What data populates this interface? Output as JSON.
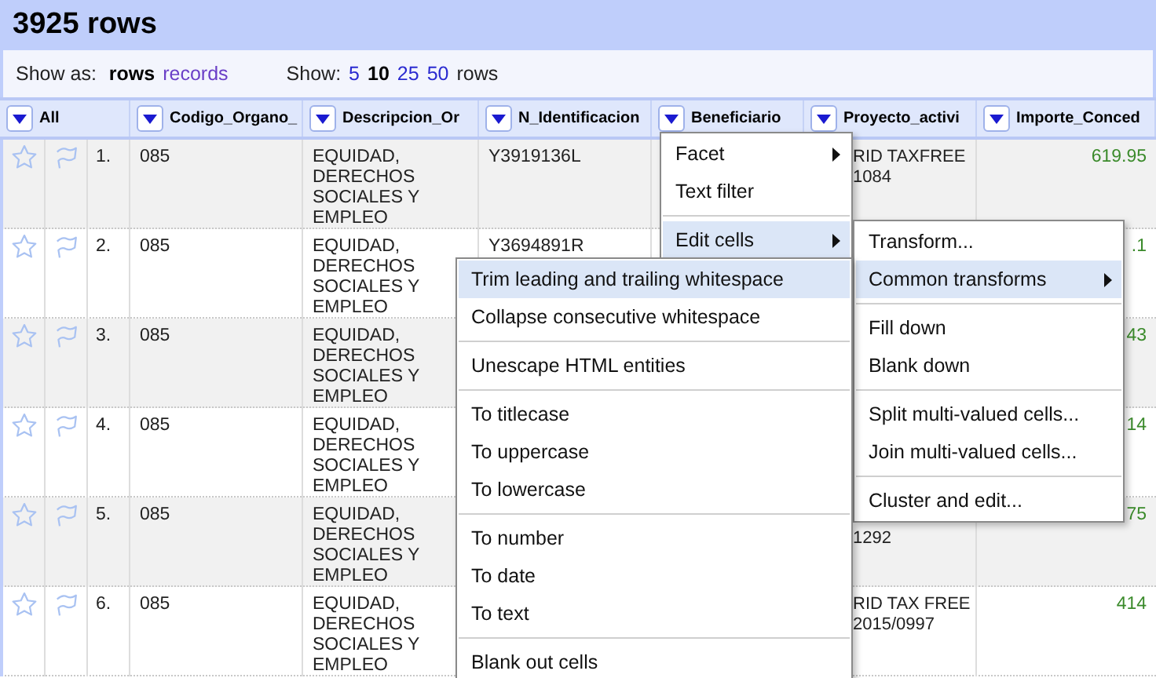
{
  "title": "3925 rows",
  "toolbar": {
    "show_as_label": "Show as:",
    "show_as": [
      {
        "label": "rows",
        "selected": true
      },
      {
        "label": "records",
        "selected": false
      }
    ],
    "show_label": "Show:",
    "page_sizes": [
      {
        "label": "5",
        "selected": false
      },
      {
        "label": "10",
        "selected": true
      },
      {
        "label": "25",
        "selected": false
      },
      {
        "label": "50",
        "selected": false
      }
    ],
    "show_suffix": "rows"
  },
  "columns": [
    "All",
    "Codigo_Organo_",
    "Descripcion_Or",
    "N_Identificacion",
    "Beneficiario",
    "Proyecto_activi",
    "Importe_Conced"
  ],
  "rows": [
    {
      "index": "1.",
      "codigo": "085",
      "descripcion": "EQUIDAD, DERECHOS SOCIALES Y EMPLEO",
      "n_identificacion": "Y3919136L",
      "proyecto": "RID TAXFREE 1084",
      "importe": "619.95"
    },
    {
      "index": "2.",
      "codigo": "085",
      "descripcion": "EQUIDAD, DERECHOS SOCIALES Y EMPLEO",
      "n_identificacion": "Y3694891R",
      "importe": ".1"
    },
    {
      "index": "3.",
      "codigo": "085",
      "descripcion": "EQUIDAD, DERECHOS SOCIALES Y EMPLEO",
      "importe": "43"
    },
    {
      "index": "4.",
      "codigo": "085",
      "descripcion": "EQUIDAD, DERECHOS SOCIALES Y EMPLEO",
      "importe": "14"
    },
    {
      "index": "5.",
      "codigo": "085",
      "descripcion": "EQUIDAD, DERECHOS SOCIALES Y EMPLEO",
      "proyecto": "1292",
      "proyecto_continued": true,
      "importe": "75"
    },
    {
      "index": "6.",
      "codigo": "085",
      "descripcion": "EQUIDAD, DERECHOS SOCIALES Y EMPLEO",
      "proyecto": "RID TAX FREE 2015/0997",
      "importe": "414"
    }
  ],
  "menus": [
    {
      "groups": [
        [
          {
            "label": "Facet",
            "submenu": true,
            "selected": false
          },
          {
            "label": "Text filter",
            "submenu": false,
            "selected": false
          }
        ],
        [
          {
            "label": "Edit cells",
            "submenu": true,
            "selected": true
          }
        ]
      ]
    },
    {
      "groups": [
        [
          {
            "label": "Transform...",
            "submenu": false,
            "selected": false
          },
          {
            "label": "Common transforms",
            "submenu": true,
            "selected": true
          }
        ],
        [
          {
            "label": "Fill down",
            "submenu": false,
            "selected": false
          },
          {
            "label": "Blank down",
            "submenu": false,
            "selected": false
          }
        ],
        [
          {
            "label": "Split multi-valued cells...",
            "submenu": false,
            "selected": false
          },
          {
            "label": "Join multi-valued cells...",
            "submenu": false,
            "selected": false
          }
        ],
        [
          {
            "label": "Cluster and edit...",
            "submenu": false,
            "selected": false
          }
        ]
      ]
    },
    {
      "groups": [
        [
          {
            "label": "Trim leading and trailing whitespace",
            "submenu": false,
            "selected": true
          },
          {
            "label": "Collapse consecutive whitespace",
            "submenu": false,
            "selected": false
          }
        ],
        [
          {
            "label": "Unescape HTML entities",
            "submenu": false,
            "selected": false
          }
        ],
        [
          {
            "label": "To titlecase",
            "submenu": false,
            "selected": false
          },
          {
            "label": "To uppercase",
            "submenu": false,
            "selected": false
          },
          {
            "label": "To lowercase",
            "submenu": false,
            "selected": false
          }
        ],
        [
          {
            "label": "To number",
            "submenu": false,
            "selected": false
          },
          {
            "label": "To date",
            "submenu": false,
            "selected": false
          },
          {
            "label": "To text",
            "submenu": false,
            "selected": false
          }
        ],
        [
          {
            "label": "Blank out cells",
            "submenu": false,
            "selected": false
          }
        ]
      ]
    }
  ]
}
